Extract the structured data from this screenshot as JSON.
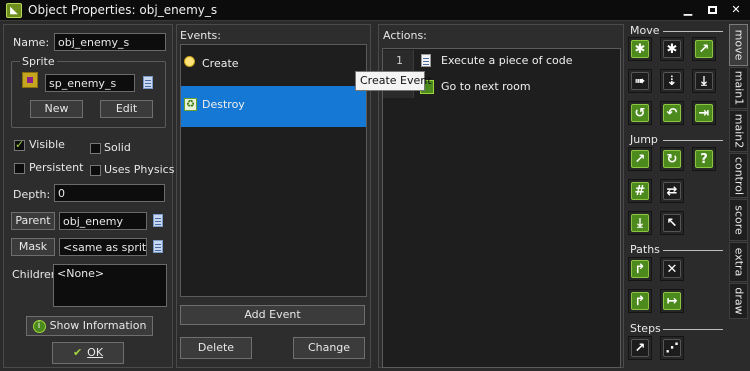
{
  "window": {
    "title": "Object Properties: obj_enemy_s",
    "min_glyph": "▁",
    "close_glyph": "✕"
  },
  "left": {
    "name_label": "Name:",
    "name_value": "obj_enemy_s",
    "sprite_group": "Sprite",
    "sprite_value": "sp_enemy_s",
    "new_label": "New",
    "edit_label": "Edit",
    "visible_label": "Visible",
    "visible_checked": true,
    "solid_label": "Solid",
    "solid_checked": false,
    "persistent_label": "Persistent",
    "persistent_checked": false,
    "uses_physics_label": "Uses Physics",
    "uses_physics_checked": false,
    "depth_label": "Depth:",
    "depth_value": "0",
    "parent_label": "Parent",
    "parent_value": "obj_enemy",
    "mask_label": "Mask",
    "mask_value": "<same as sprite>",
    "children_label": "Children:",
    "children_value": "<None>",
    "show_info_label": "Show Information",
    "ok_label": "OK"
  },
  "events": {
    "header": "Events:",
    "items": [
      {
        "label": "Create",
        "icon": "lightbulb-icon",
        "selected": false
      },
      {
        "label": "Destroy",
        "icon": "recycle-icon",
        "selected": true
      }
    ],
    "add_event_label": "Add Event",
    "delete_label": "Delete",
    "change_label": "Change"
  },
  "actions": {
    "header": "Actions:",
    "items": [
      {
        "num": "1",
        "label": "Execute a piece of code",
        "icon": "code-document-icon"
      },
      {
        "num": "",
        "label": "Go to next room",
        "icon": "next-room-icon"
      }
    ]
  },
  "tooltip": {
    "text": "Create Event"
  },
  "library": {
    "sections": {
      "move": "Move",
      "jump": "Jump",
      "paths": "Paths",
      "steps": "Steps"
    },
    "tabs": [
      "move",
      "main1",
      "main2",
      "control",
      "score",
      "extra",
      "draw"
    ],
    "active_tab": "move"
  }
}
